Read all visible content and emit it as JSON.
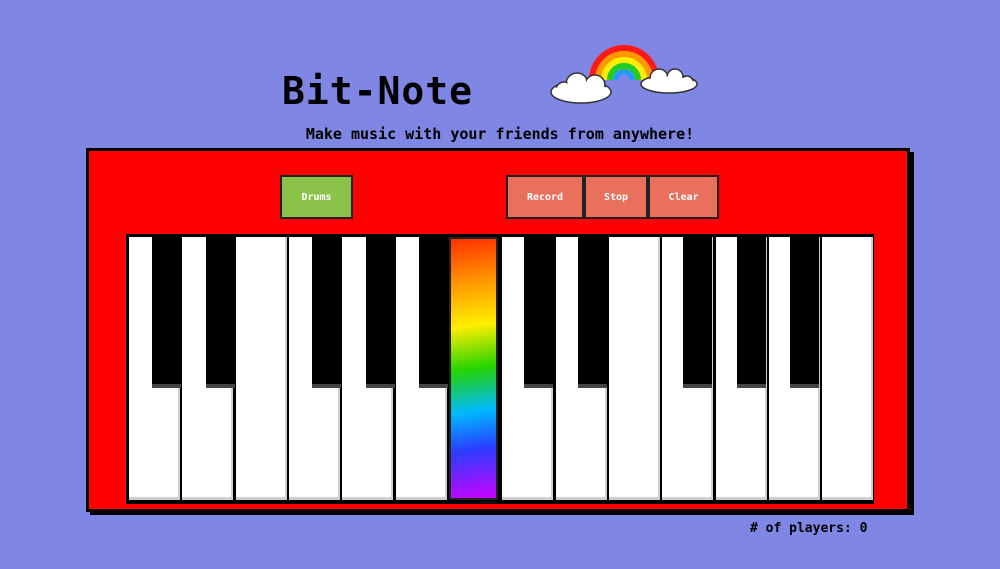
{
  "app": {
    "title": "Bit-Note",
    "subtitle": "Make music with your friends from anywhere!",
    "logo_icon": "rainbow-cloud-icon"
  },
  "controls": {
    "drums_label": "Drums",
    "record_label": "Record",
    "stop_label": "Stop",
    "clear_label": "Clear"
  },
  "keyboard": {
    "white_key_count": 14,
    "black_key_count": 10,
    "highlighted_key": "rainbow",
    "colors": {
      "body": "#ff0000",
      "drums_button": "#8bc34a",
      "control_button": "#e8705c",
      "background": "#7f86e3"
    }
  },
  "status": {
    "players_label": "# of players: 0"
  }
}
